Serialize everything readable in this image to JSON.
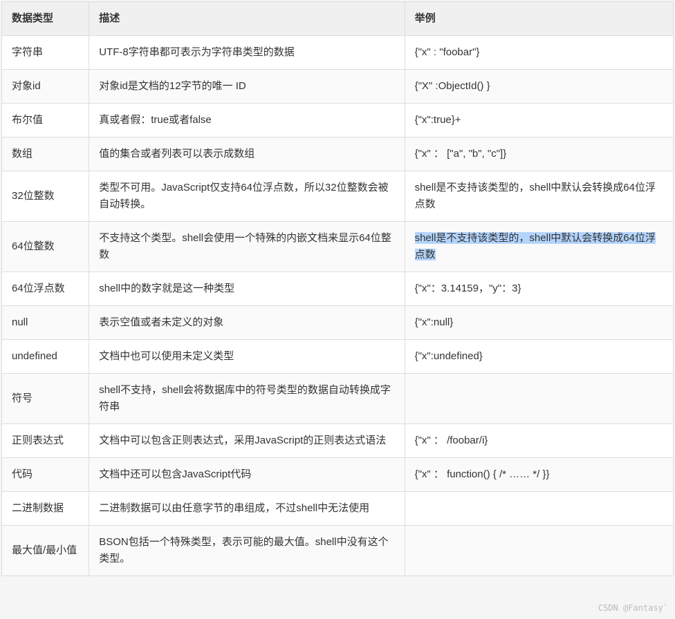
{
  "headers": {
    "col1": "数据类型",
    "col2": "描述",
    "col3": "举例"
  },
  "rows": [
    {
      "type": "字符串",
      "desc": "UTF-8字符串都可表示为字符串类型的数据",
      "example": "{\"x\"   : \"foobar\"}"
    },
    {
      "type": "对象id",
      "desc": "对象id是文档的12字节的唯一   ID",
      "example": "{\"X\"   :ObjectId() }"
    },
    {
      "type": "布尔值",
      "desc": "真或者假：true或者false",
      "example": "{\"x\":true}+"
    },
    {
      "type": "数组",
      "desc": "值的集合或者列表可以表示成数组",
      "example": "{\"x\"   ：   [\"a\",   \"b\", \"c\"]}"
    },
    {
      "type": "32位整数",
      "desc": "类型不可用。JavaScript仅支持64位浮点数，所以32位整数会被自动转换。",
      "example": "shell是不支持该类型的，shell中默认会转换成64位浮点数"
    },
    {
      "type": "64位整数",
      "desc": "不支持这个类型。shell会使用一个特殊的内嵌文档来显示64位整数",
      "example": "shell是不支持该类型的，shell中默认会转换成64位浮点数",
      "highlighted": true
    },
    {
      "type": "64位浮点数",
      "desc": "shell中的数字就是这一种类型",
      "example": "{\"x\"：3.14159，\"y\"：3}"
    },
    {
      "type": "null",
      "desc": "表示空值或者未定义的对象",
      "example": "{\"x\":null}"
    },
    {
      "type": "undefined",
      "desc": "文档中也可以使用未定义类型",
      "example": "{\"x\":undefined}"
    },
    {
      "type": "符号",
      "desc": "shell不支持，shell会将数据库中的符号类型的数据自动转换成字符串",
      "example": ""
    },
    {
      "type": "正则表达式",
      "desc": "文档中可以包含正则表达式，采用JavaScript的正则表达式语法",
      "example": "{\"x\"   ：   /foobar/i}"
    },
    {
      "type": "代码",
      "desc": "文档中还可以包含JavaScript代码",
      "example": "{\"x\"   ：   function() { /* …… */ }}"
    },
    {
      "type": "二进制数据",
      "desc": "二进制数据可以由任意字节的串组成，不过shell中无法使用",
      "example": ""
    },
    {
      "type": "最大值/最小值",
      "desc": "BSON包括一个特殊类型，表示可能的最大值。shell中没有这个类型。",
      "example": ""
    }
  ],
  "watermark": "CSDN @Fantasy`"
}
